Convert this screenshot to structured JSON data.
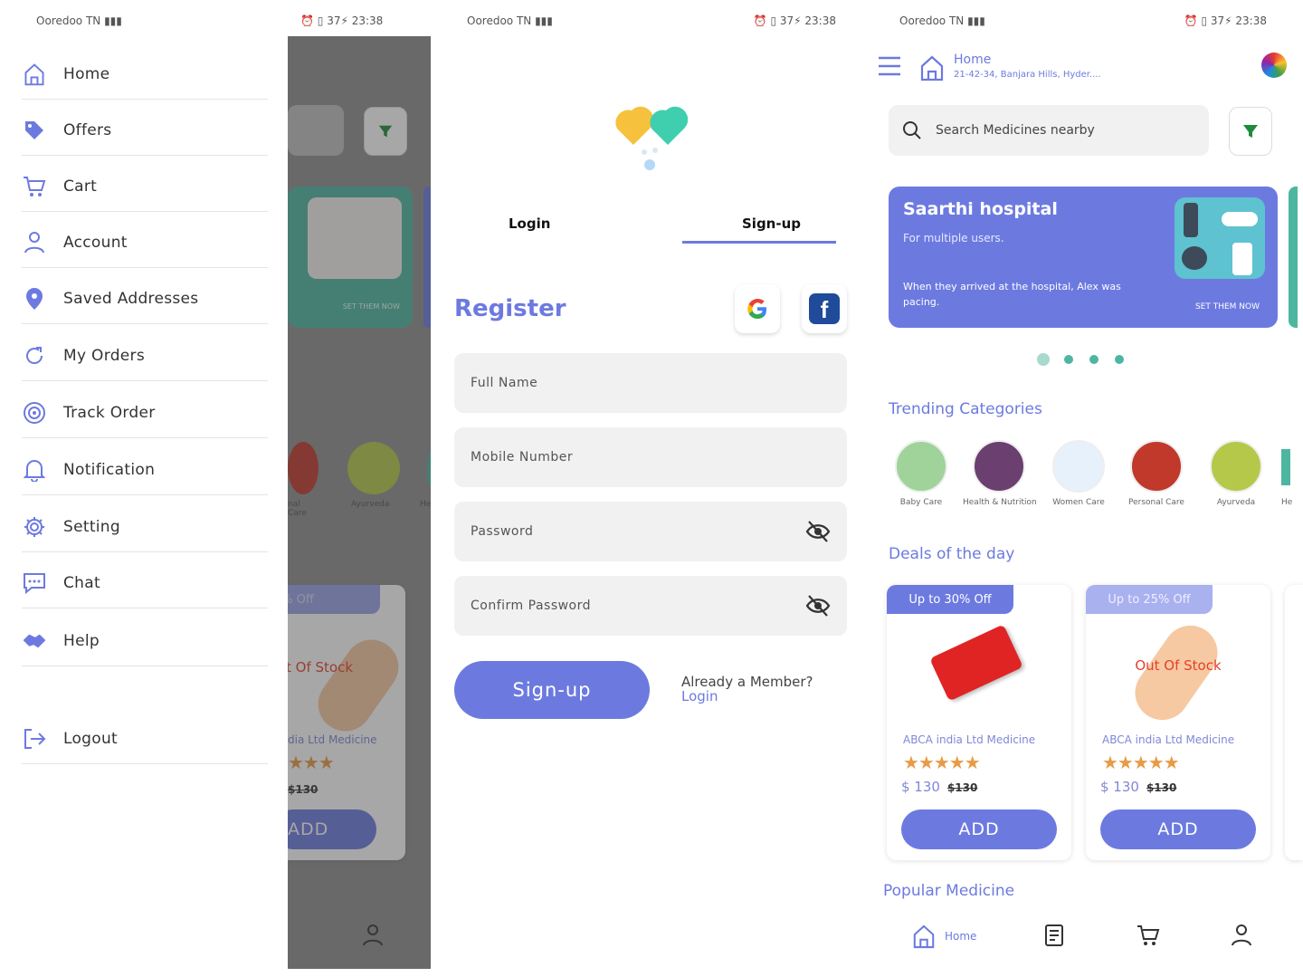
{
  "status": {
    "carrier": "Ooredoo TN",
    "time": "23:38",
    "battery": "37"
  },
  "drawer": {
    "items": [
      {
        "label": "Home",
        "icon": "home-icon"
      },
      {
        "label": "Offers",
        "icon": "tag-icon"
      },
      {
        "label": "Cart",
        "icon": "cart-icon"
      },
      {
        "label": "Account",
        "icon": "user-icon"
      },
      {
        "label": "Saved Addresses",
        "icon": "map-pin-icon"
      },
      {
        "label": "My Orders",
        "icon": "refresh-icon"
      },
      {
        "label": "Track Order",
        "icon": "target-icon"
      },
      {
        "label": "Notification",
        "icon": "bell-icon"
      },
      {
        "label": "Setting",
        "icon": "gear-icon"
      },
      {
        "label": "Chat",
        "icon": "chat-icon"
      },
      {
        "label": "Help",
        "icon": "handshake-icon"
      }
    ],
    "logout": "Logout"
  },
  "register": {
    "tabs": {
      "login": "Login",
      "signup": "Sign-up"
    },
    "title": "Register",
    "fields": {
      "full_name": "Full Name",
      "mobile": "Mobile Number",
      "password": "Password",
      "confirm": "Confirm Password"
    },
    "signup_button": "Sign-up",
    "member_text": "Already a Member?",
    "login_link": "Login"
  },
  "home": {
    "header": {
      "title": "Home",
      "address": "21-42-34, Banjara Hills, Hyder...."
    },
    "search_placeholder": "Search Medicines nearby",
    "banner": {
      "title": "Saarthi hospital",
      "subtitle": "For multiple users.",
      "text": "When they arrived at the hospital, Alex was pacing.",
      "cta": "SET THEM NOW"
    },
    "prev_banner_cta": "SET THEM NOW",
    "trending_title": "Trending Categories",
    "categories": [
      "Baby Care",
      "Health & Nutrition",
      "Women Care",
      "Personal Care",
      "Ayurveda",
      "He"
    ],
    "deals_title": "Deals of the day",
    "deals": [
      {
        "badge": "Up to 30% Off",
        "name": "ABCA india Ltd Medicine",
        "stars": "★★★★★",
        "price": "$ 130",
        "old": "$130",
        "add": "ADD",
        "status": ""
      },
      {
        "badge": "Up to 25% Off",
        "name": "ABCA india Ltd Medicine",
        "stars": "★★★★★",
        "price": "$ 130",
        "old": "$130",
        "add": "ADD",
        "status": "Out Of Stock"
      }
    ],
    "popular_title": "Popular Medicine",
    "nav": {
      "home": "Home"
    }
  },
  "colors": {
    "accent": "#6c7ae0",
    "teal": "#4db6a0",
    "star": "#e89b46",
    "out_of_stock": "#e5412a"
  }
}
